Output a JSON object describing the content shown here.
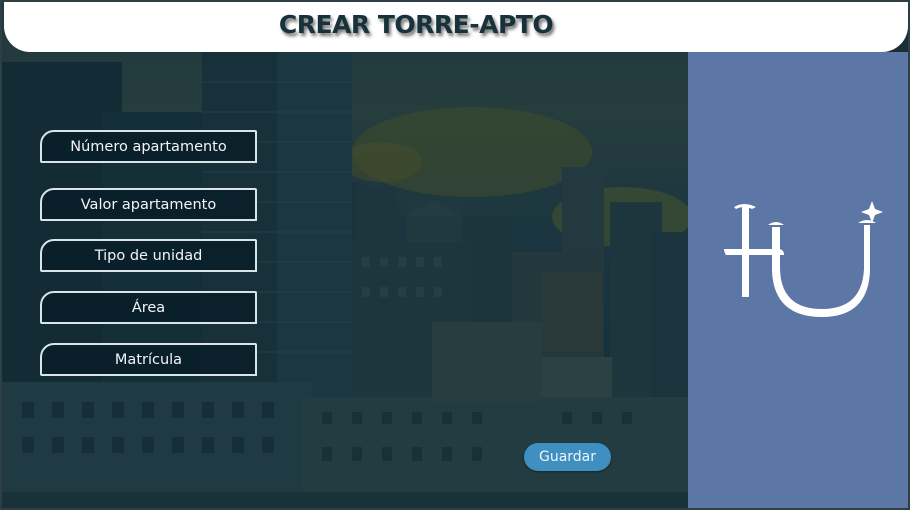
{
  "header": {
    "title": "CREAR TORRE-APTO"
  },
  "form": {
    "fields": [
      {
        "label": "Número apartamento"
      },
      {
        "label": "Valor apartamento"
      },
      {
        "label": "Tipo de unidad"
      },
      {
        "label": "Área"
      },
      {
        "label": "Matrícula"
      }
    ],
    "save_label": "Guardar"
  },
  "logo": {
    "text": "HU"
  },
  "colors": {
    "side_panel": "#5c77a6",
    "save_button": "#3f8fc0",
    "title": "#17323a"
  }
}
